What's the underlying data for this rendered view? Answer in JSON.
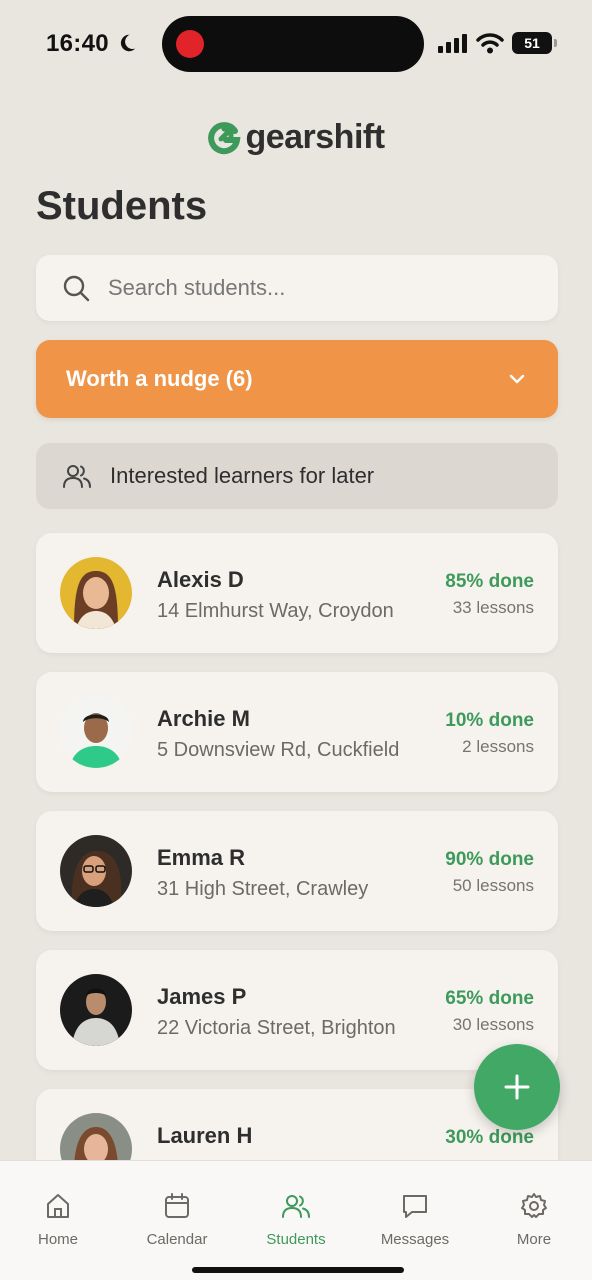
{
  "status_bar": {
    "time": "16:40",
    "battery": "51"
  },
  "app": {
    "logo_text": "gearshift",
    "brand_color": "#3d9a5b",
    "accent_color": "#f09448"
  },
  "page": {
    "title": "Students"
  },
  "search": {
    "placeholder": "Search students..."
  },
  "nudge": {
    "label": "Worth a nudge (6)"
  },
  "later": {
    "label": "Interested learners for later"
  },
  "students": [
    {
      "name": "Alexis D",
      "address": "14 Elmhurst Way, Croydon",
      "progress": "85% done",
      "lessons": "33 lessons"
    },
    {
      "name": "Archie M",
      "address": "5 Downsview Rd, Cuckfield",
      "progress": "10% done",
      "lessons": "2 lessons"
    },
    {
      "name": "Emma R",
      "address": "31 High Street, Crawley",
      "progress": "90% done",
      "lessons": "50 lessons"
    },
    {
      "name": "James P",
      "address": "22 Victoria Street, Brighton",
      "progress": "65% done",
      "lessons": "30 lessons"
    },
    {
      "name": "Lauren H",
      "address": "",
      "progress": "30% done",
      "lessons": ""
    }
  ],
  "tabs": [
    {
      "label": "Home",
      "icon": "home-icon"
    },
    {
      "label": "Calendar",
      "icon": "calendar-icon"
    },
    {
      "label": "Students",
      "icon": "users-icon",
      "active": true
    },
    {
      "label": "Messages",
      "icon": "message-icon"
    },
    {
      "label": "More",
      "icon": "gear-icon"
    }
  ]
}
